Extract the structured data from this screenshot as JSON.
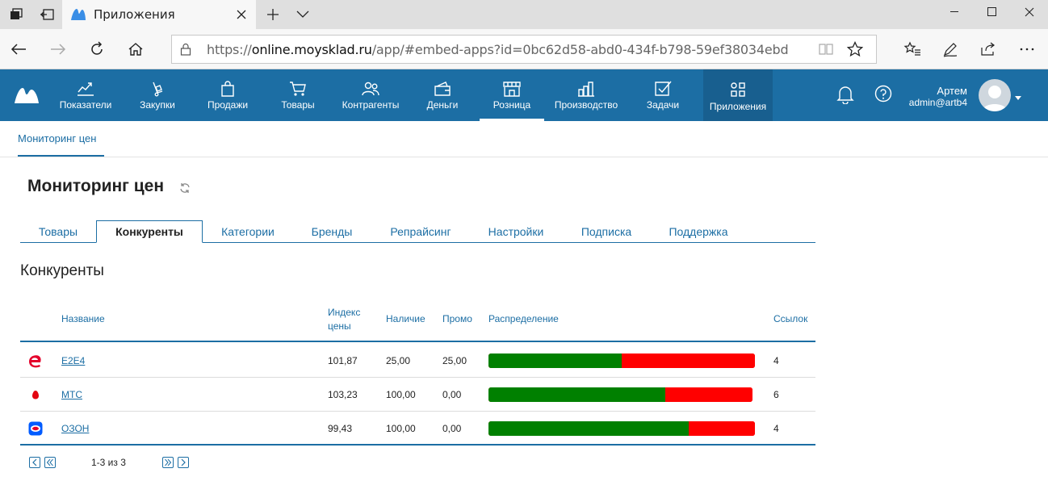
{
  "browser": {
    "tab_title": "Приложения",
    "url_prefix": "https://",
    "url_host": "online.moysklad.ru",
    "url_path": "/app/#embed-apps?id=0bc62d58-abd0-434f-b798-59ef38034ebd"
  },
  "nav": {
    "items": [
      {
        "label": "Показатели",
        "icon": "chart-icon"
      },
      {
        "label": "Закупки",
        "icon": "purchase-icon"
      },
      {
        "label": "Продажи",
        "icon": "bag-icon"
      },
      {
        "label": "Товары",
        "icon": "cart-icon"
      },
      {
        "label": "Контрагенты",
        "icon": "people-icon"
      },
      {
        "label": "Деньги",
        "icon": "wallet-icon"
      },
      {
        "label": "Розница",
        "icon": "store-icon"
      },
      {
        "label": "Производство",
        "icon": "factory-icon"
      },
      {
        "label": "Задачи",
        "icon": "check-icon"
      },
      {
        "label": "Приложения",
        "icon": "apps-icon"
      }
    ]
  },
  "user": {
    "name": "Артем",
    "email": "admin@artb4"
  },
  "subnav": {
    "label": "Мониторинг цен"
  },
  "page": {
    "title": "Мониторинг цен",
    "section_title": "Конкуренты"
  },
  "tabs": [
    "Товары",
    "Конкуренты",
    "Категории",
    "Бренды",
    "Репрайсинг",
    "Настройки",
    "Подписка",
    "Поддержка"
  ],
  "table": {
    "headers": {
      "name": "Название",
      "index_line1": "Индекс",
      "index_line2": "цены",
      "stock": "Наличие",
      "promo": "Промо",
      "distribution": "Распределение",
      "links": "Ссылок"
    },
    "rows": [
      {
        "name": "E2E4",
        "index": "101,87",
        "stock": "25,00",
        "promo": "25,00",
        "links": "4",
        "green_share": 0.5,
        "icon": "e2e4-logo-icon",
        "color": "#e4002b"
      },
      {
        "name": "МТС",
        "index": "103,23",
        "stock": "100,00",
        "promo": "0,00",
        "links": "6",
        "green_share": 0.67,
        "icon": "mts-logo-icon",
        "color": "#e30611"
      },
      {
        "name": "ОЗОН",
        "index": "99,43",
        "stock": "100,00",
        "promo": "0,00",
        "links": "4",
        "green_share": 0.75,
        "icon": "ozon-logo-icon",
        "color": "#005bff"
      }
    ]
  },
  "pager": {
    "text": "1-3 из 3"
  },
  "colors": {
    "brand": "#1c6ea4",
    "green": "#008000",
    "red": "#ff0000"
  }
}
